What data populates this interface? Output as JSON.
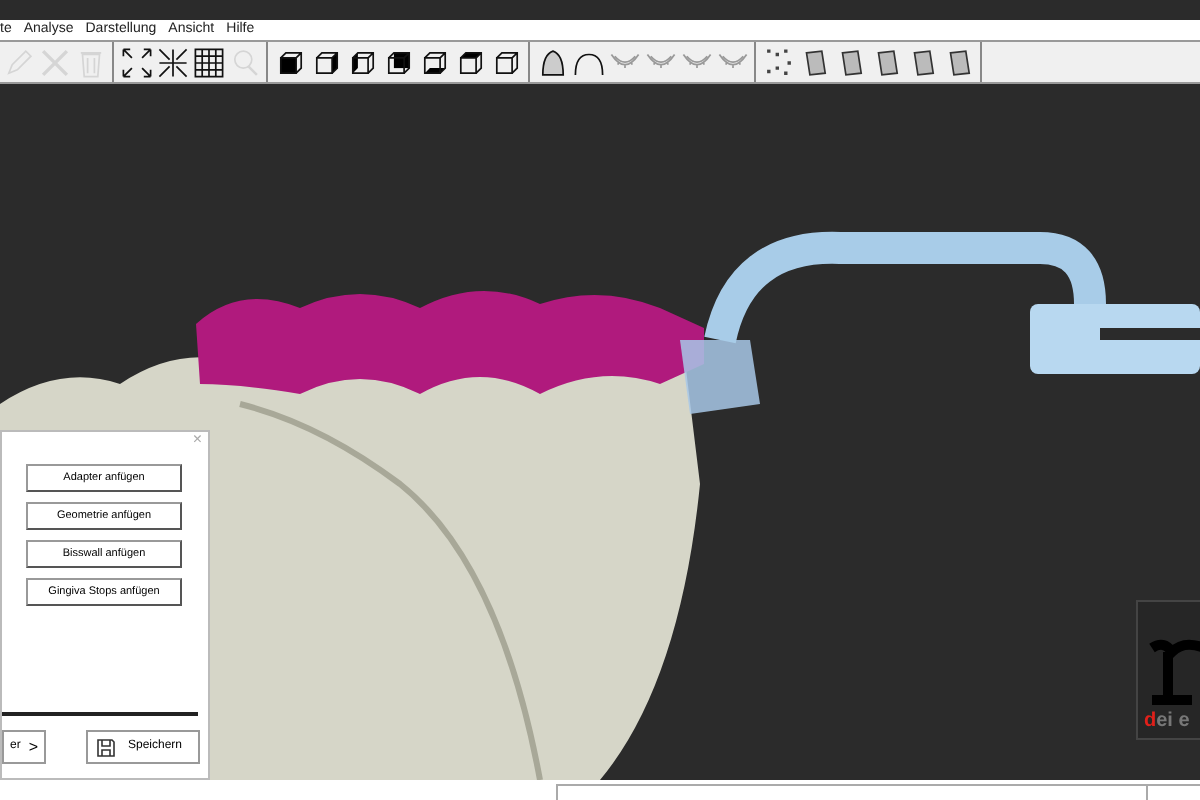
{
  "menu": [
    "te",
    "Analyse",
    "Darstellung",
    "Ansicht",
    "Hilfe"
  ],
  "toolbar": [
    {
      "kind": "pencil",
      "disabled": true
    },
    {
      "kind": "cross",
      "disabled": true
    },
    {
      "kind": "trash",
      "disabled": true
    },
    {
      "kind": "sep"
    },
    {
      "kind": "expand",
      "disabled": false
    },
    {
      "kind": "compress",
      "disabled": false
    },
    {
      "kind": "grid",
      "disabled": false
    },
    {
      "kind": "search",
      "disabled": true
    },
    {
      "kind": "sep"
    },
    {
      "kind": "frontcube",
      "disabled": false
    },
    {
      "kind": "rightcube",
      "disabled": false
    },
    {
      "kind": "leftcube",
      "disabled": false
    },
    {
      "kind": "backcube",
      "disabled": false
    },
    {
      "kind": "bottomcube",
      "disabled": false
    },
    {
      "kind": "topcube",
      "disabled": false
    },
    {
      "kind": "cube",
      "disabled": false
    },
    {
      "kind": "sep"
    },
    {
      "kind": "bell",
      "disabled": false
    },
    {
      "kind": "dome",
      "disabled": false
    },
    {
      "kind": "jaw",
      "disabled": false
    },
    {
      "kind": "jaw",
      "disabled": false
    },
    {
      "kind": "jaw",
      "disabled": false
    },
    {
      "kind": "jaw",
      "disabled": false
    },
    {
      "kind": "sep"
    },
    {
      "kind": "dots",
      "disabled": false
    },
    {
      "kind": "cylinder",
      "disabled": false
    },
    {
      "kind": "cylinder",
      "disabled": false
    },
    {
      "kind": "cylinder",
      "disabled": false
    },
    {
      "kind": "cylinder",
      "disabled": false
    },
    {
      "kind": "cylinder",
      "disabled": false
    },
    {
      "kind": "sep"
    }
  ],
  "dialog": {
    "close": "×",
    "buttons": [
      "Adapter anfügen",
      "Geometrie anfügen",
      "Bisswall anfügen",
      "Gingiva Stops anfügen"
    ],
    "next_button": {
      "label": "er",
      "arrow": ">"
    },
    "save_button": "Speichern"
  },
  "logo": {
    "accent": "d",
    "rest": "ei e"
  }
}
